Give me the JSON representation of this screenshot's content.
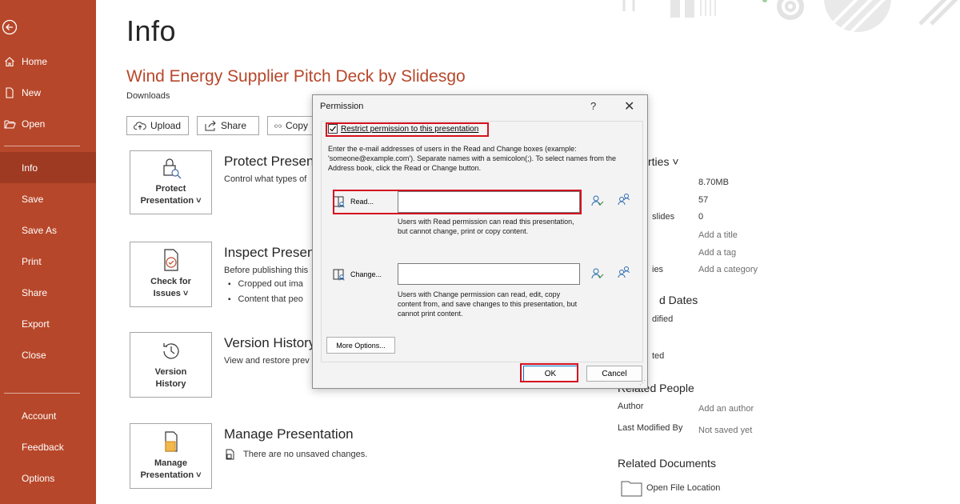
{
  "sidebar": {
    "back_icon": "back-arrow-circle-icon",
    "items": [
      {
        "label": "Home",
        "icon": "home-icon"
      },
      {
        "label": "New",
        "icon": "new-document-icon"
      },
      {
        "label": "Open",
        "icon": "folder-open-icon"
      },
      {
        "label": "Info"
      },
      {
        "label": "Save"
      },
      {
        "label": "Save As"
      },
      {
        "label": "Print"
      },
      {
        "label": "Share"
      },
      {
        "label": "Export"
      },
      {
        "label": "Close"
      },
      {
        "label": "Account"
      },
      {
        "label": "Feedback"
      },
      {
        "label": "Options"
      }
    ],
    "active": "Info",
    "colors": {
      "background": "#b7472a",
      "active": "#9e3a21"
    }
  },
  "main": {
    "page_title": "Info",
    "doc_title": "Wind Energy Supplier Pitch Deck by Slidesgo",
    "doc_path": "Downloads",
    "buttons": {
      "upload": "Upload",
      "share": "Share",
      "copy": "Copy"
    },
    "sections": {
      "protect": {
        "tile_line1": "Protect",
        "tile_line2": "Presentation ˅",
        "heading": "Protect Presen",
        "text": "Control what types of"
      },
      "inspect": {
        "tile_line1": "Check for",
        "tile_line2": "Issues ˅",
        "heading": "Inspect Presen",
        "text": "Before publishing this",
        "bullets": [
          "Cropped out ima",
          "Content that peo"
        ]
      },
      "version": {
        "tile_line1": "Version",
        "tile_line2": "History",
        "heading": "Version History",
        "text": "View and restore prev"
      },
      "manage": {
        "tile_line1": "Manage",
        "tile_line2": "Presentation ˅",
        "heading": "Manage Presentation",
        "text": "There are no unsaved changes."
      }
    },
    "properties": {
      "heading": "rties ˅",
      "values": [
        "8.70MB",
        "57",
        "0",
        "Add a title",
        "Add a tag",
        "Add a category"
      ],
      "labels": {
        "hidden_slides": "slides",
        "categories": "ies"
      },
      "dates_heading": "d Dates",
      "modified": "dified",
      "created": "ted",
      "related_people_heading": "Related People",
      "author_label": "Author",
      "author_value": "Add an author",
      "last_modified_label": "Last Modified By",
      "last_modified_value": "Not saved yet",
      "related_docs_heading": "Related Documents",
      "open_location": "Open File Location"
    },
    "accent_color": "#b7472a"
  },
  "dialog": {
    "title": "Permission",
    "help": "?",
    "close": "✕",
    "restrict_label": "Restrict permission to this presentation",
    "restrict_checked": true,
    "description": "Enter the e-mail addresses of users in the Read and Change boxes (example: 'someone@example.com'). Separate names with a semicolon(;). To select names from the Address book, click the Read or Change button.",
    "read_label": "Read...",
    "read_value": "",
    "read_note": "Users with Read permission can read this presentation, but cannot change, print or copy content.",
    "change_label": "Change...",
    "change_value": "",
    "change_note": "Users with Change permission can read, edit, copy content from, and save changes to this presentation, but cannot print content.",
    "more_options": "More Options...",
    "ok": "OK",
    "cancel": "Cancel",
    "highlight_color": "#d4101e"
  }
}
